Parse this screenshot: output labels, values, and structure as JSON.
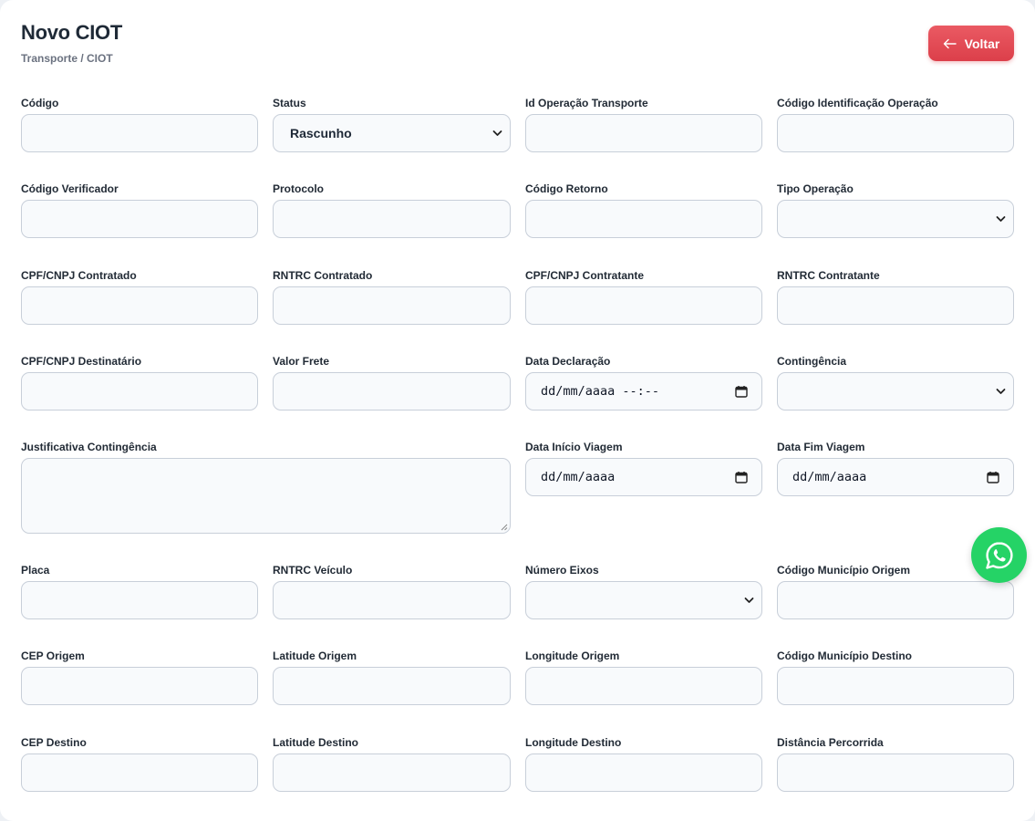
{
  "header": {
    "title": "Novo CIOT",
    "breadcrumb": "Transporte / CIOT",
    "back_label": "Voltar"
  },
  "colors": {
    "accent": "#dc3f4a",
    "whatsapp": "#25d366",
    "input_border": "#c8cfd9",
    "input_bg": "#f8fafc"
  },
  "form": {
    "codigo": {
      "label": "Código",
      "value": ""
    },
    "status": {
      "label": "Status",
      "value": "Rascunho"
    },
    "id_operacao_transporte": {
      "label": "Id Operação Transporte",
      "value": ""
    },
    "codigo_identificacao_operacao": {
      "label": "Código Identificação Operação",
      "value": ""
    },
    "codigo_verificador": {
      "label": "Código Verificador",
      "value": ""
    },
    "protocolo": {
      "label": "Protocolo",
      "value": ""
    },
    "codigo_retorno": {
      "label": "Código Retorno",
      "value": ""
    },
    "tipo_operacao": {
      "label": "Tipo Operação",
      "value": ""
    },
    "cpf_cnpj_contratado": {
      "label": "CPF/CNPJ Contratado",
      "value": ""
    },
    "rntrc_contratado": {
      "label": "RNTRC Contratado",
      "value": ""
    },
    "cpf_cnpj_contratante": {
      "label": "CPF/CNPJ Contratante",
      "value": ""
    },
    "rntrc_contratante": {
      "label": "RNTRC Contratante",
      "value": ""
    },
    "cpf_cnpj_destinatario": {
      "label": "CPF/CNPJ Destinatário",
      "value": ""
    },
    "valor_frete": {
      "label": "Valor Frete",
      "value": ""
    },
    "data_declaracao": {
      "label": "Data Declaração",
      "value": "dd/mm/aaaa --:--"
    },
    "contingencia": {
      "label": "Contingência",
      "value": ""
    },
    "justificativa_contingencia": {
      "label": "Justificativa Contingência",
      "value": ""
    },
    "data_inicio_viagem": {
      "label": "Data Início Viagem",
      "value": "dd/mm/aaaa"
    },
    "data_fim_viagem": {
      "label": "Data Fim Viagem",
      "value": "dd/mm/aaaa"
    },
    "placa": {
      "label": "Placa",
      "value": ""
    },
    "rntrc_veiculo": {
      "label": "RNTRC Veículo",
      "value": ""
    },
    "numero_eixos": {
      "label": "Número Eixos",
      "value": ""
    },
    "codigo_municipio_origem": {
      "label": "Código Município Origem",
      "value": ""
    },
    "cep_origem": {
      "label": "CEP Origem",
      "value": ""
    },
    "latitude_origem": {
      "label": "Latitude Origem",
      "value": ""
    },
    "longitude_origem": {
      "label": "Longitude Origem",
      "value": ""
    },
    "codigo_municipio_destino": {
      "label": "Código Município Destino",
      "value": ""
    },
    "cep_destino": {
      "label": "CEP Destino",
      "value": ""
    },
    "latitude_destino": {
      "label": "Latitude Destino",
      "value": ""
    },
    "longitude_destino": {
      "label": "Longitude Destino",
      "value": ""
    },
    "distancia_percorrida": {
      "label": "Distância Percorrida",
      "value": ""
    }
  }
}
